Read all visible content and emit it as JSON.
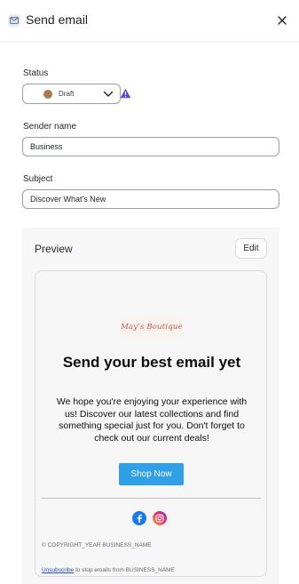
{
  "header": {
    "title": "Send email",
    "icon": "mail-icon",
    "close_icon": "close-icon"
  },
  "status": {
    "label": "Status",
    "value": "Draft",
    "dot_color": "#a97b4f",
    "warning_icon": "warning-icon",
    "warning_color": "#5b4bd1"
  },
  "sender": {
    "label": "Sender name",
    "value": "Business"
  },
  "subject": {
    "label": "Subject",
    "value": "Discover What's New"
  },
  "preview": {
    "title": "Preview",
    "edit_label": "Edit"
  },
  "email": {
    "logo_text": "May's Boutique",
    "heading": "Send your best email yet",
    "body": "We hope you're enjoying your experience with us! Discover our latest collections and find something special just for you. Don't forget to check out our current deals!",
    "cta_label": "Shop Now",
    "cta_color": "#2f9fe6",
    "social_icons": [
      "facebook-icon",
      "instagram-icon"
    ],
    "copyright": "© COPYRIGHT_YEAR BUSINESS_NAME",
    "unsubscribe_link": "Unsubscribe",
    "unsubscribe_text": " to stop emails from BUSINESS_NAME"
  }
}
